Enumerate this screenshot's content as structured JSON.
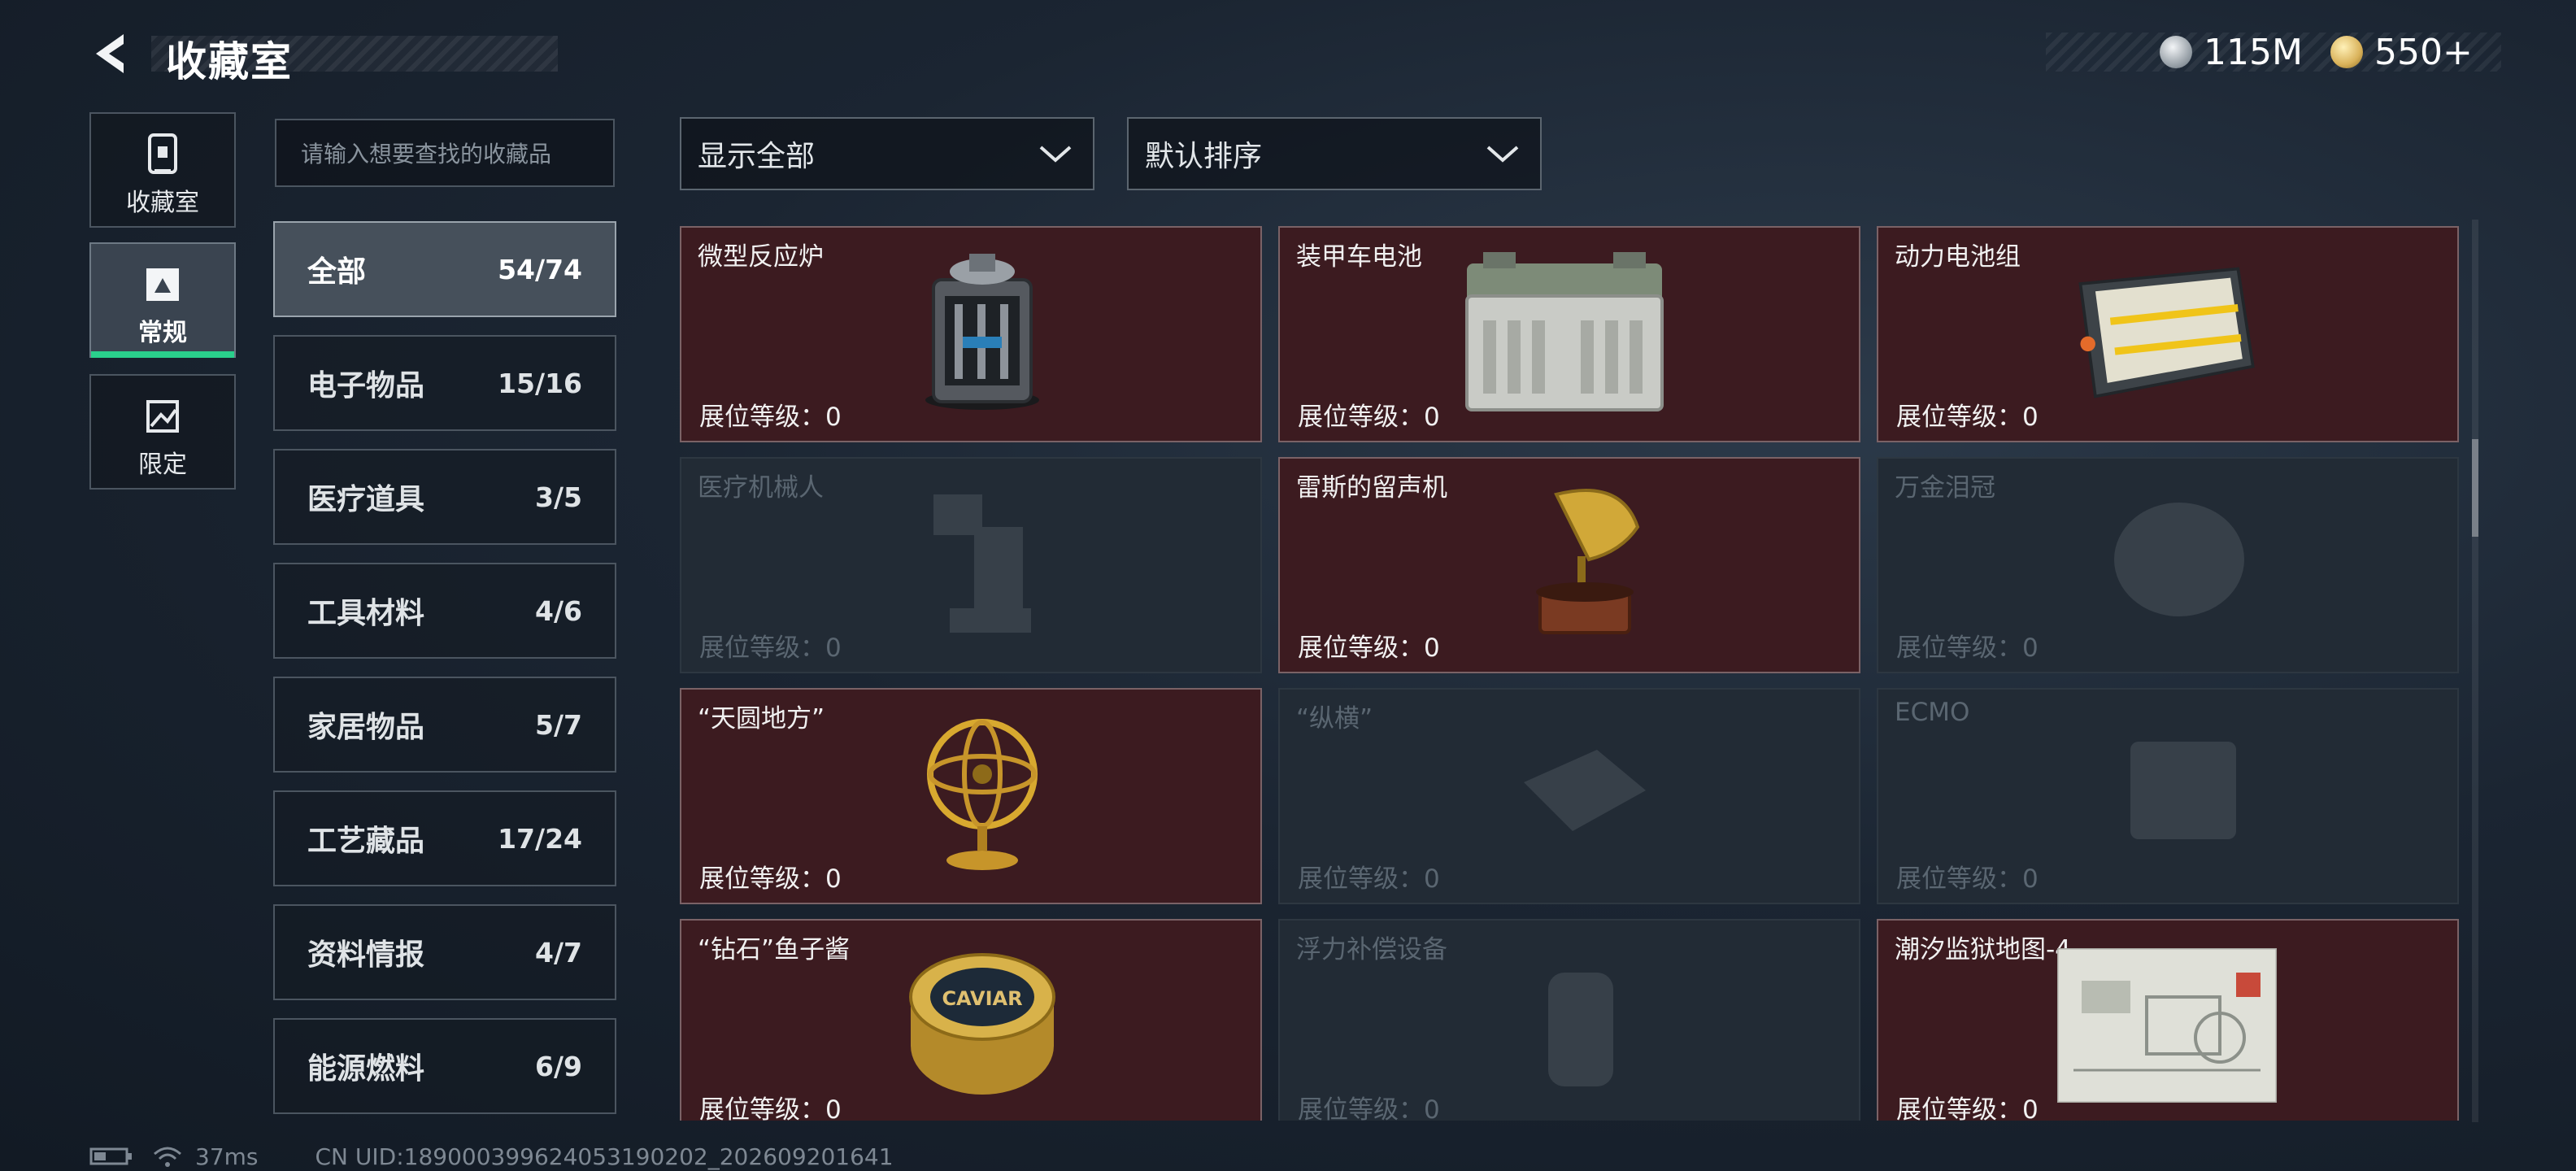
{
  "header": {
    "title": "收藏室",
    "currencies": [
      {
        "icon": "silver-coin-icon",
        "value": "115M",
        "color": "#c9cfd4"
      },
      {
        "icon": "gold-coin-icon",
        "value": "550+",
        "color": "#d9b25a"
      }
    ]
  },
  "rail": [
    {
      "label": "收藏室",
      "icon": "collection-room-icon"
    },
    {
      "label": "常规",
      "icon": "regular-icon",
      "active": true
    },
    {
      "label": "限定",
      "icon": "limited-icon"
    }
  ],
  "search": {
    "placeholder": "请输入想要查找的收藏品"
  },
  "categories": [
    {
      "name": "全部",
      "count": "54/74",
      "active": true
    },
    {
      "name": "电子物品",
      "count": "15/16"
    },
    {
      "name": "医疗道具",
      "count": "3/5"
    },
    {
      "name": "工具材料",
      "count": "4/6"
    },
    {
      "name": "家居物品",
      "count": "5/7"
    },
    {
      "name": "工艺藏品",
      "count": "17/24"
    },
    {
      "name": "资料情报",
      "count": "4/7"
    },
    {
      "name": "能源燃料",
      "count": "6/9"
    }
  ],
  "filters": {
    "show": "显示全部",
    "sort": "默认排序"
  },
  "items": [
    {
      "name": "微型反应炉",
      "level": "展位等级：0",
      "owned": true
    },
    {
      "name": "装甲车电池",
      "level": "展位等级：0",
      "owned": true
    },
    {
      "name": "动力电池组",
      "level": "展位等级：0",
      "owned": true
    },
    {
      "name": "医疗机械人",
      "level": "展位等级：0",
      "owned": false
    },
    {
      "name": "雷斯的留声机",
      "level": "展位等级：0",
      "owned": true
    },
    {
      "name": "万金泪冠",
      "level": "展位等级：0",
      "owned": false
    },
    {
      "name": "“天圆地方”",
      "level": "展位等级：0",
      "owned": true
    },
    {
      "name": "“纵横”",
      "level": "展位等级：0",
      "owned": false
    },
    {
      "name": "ECMO",
      "level": "展位等级：0",
      "owned": false
    },
    {
      "name": "“钻石”鱼子酱",
      "level": "展位等级：0",
      "owned": true,
      "label": "CAVIAR"
    },
    {
      "name": "浮力补偿设备",
      "level": "展位等级：0",
      "owned": false
    },
    {
      "name": "潮汐监狱地图-4",
      "level": "展位等级：0",
      "owned": true
    }
  ],
  "status": {
    "ping": "37ms",
    "uid": "CN UID:189000399624053190202_202609201641"
  }
}
